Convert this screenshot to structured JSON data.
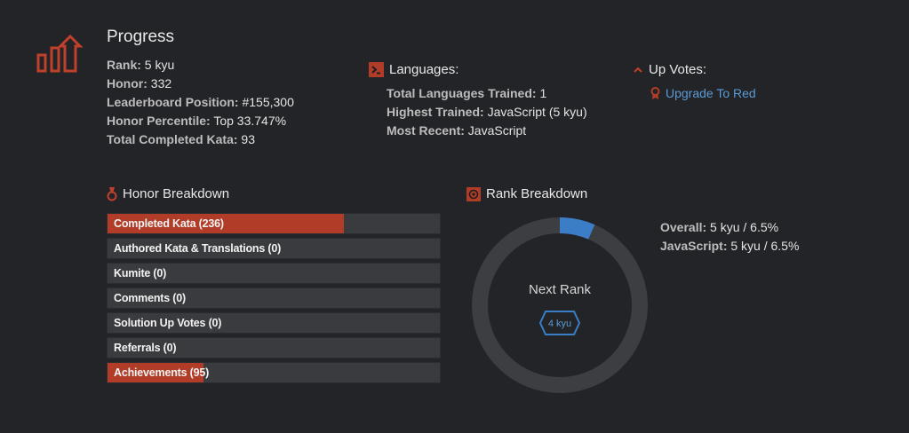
{
  "progress": {
    "title": "Progress",
    "icon": "bar-chart-up-arrow-icon",
    "rank_label": "Rank:",
    "rank": "5 kyu",
    "honor_label": "Honor:",
    "honor": "332",
    "leaderboard_label": "Leaderboard Position:",
    "leaderboard": "#155,300",
    "percentile_label": "Honor Percentile:",
    "percentile": "Top 33.747%",
    "completed_label": "Total Completed Kata:",
    "completed": "93"
  },
  "languages": {
    "title": "Languages:",
    "icon": "terminal-icon",
    "trained_label": "Total Languages Trained:",
    "trained": "1",
    "highest_label": "Highest Trained:",
    "highest": "JavaScript (5 kyu)",
    "recent_label": "Most Recent:",
    "recent": "JavaScript"
  },
  "upvotes": {
    "title": "Up Votes:",
    "icon": "chevron-up-icon",
    "link_icon": "ribbon-icon",
    "link": "Upgrade To Red"
  },
  "honor_breakdown": {
    "title": "Honor Breakdown",
    "icon": "medal-icon",
    "bars": [
      {
        "label": "Completed Kata (236)",
        "fraction": 0.71
      },
      {
        "label": "Authored Kata & Translations (0)",
        "fraction": 0
      },
      {
        "label": "Kumite (0)",
        "fraction": 0
      },
      {
        "label": "Comments (0)",
        "fraction": 0
      },
      {
        "label": "Solution Up Votes (0)",
        "fraction": 0
      },
      {
        "label": "Referrals (0)",
        "fraction": 0
      },
      {
        "label": "Achievements (95)",
        "fraction": 0.29
      }
    ]
  },
  "rank_breakdown": {
    "title": "Rank Breakdown",
    "icon": "target-icon",
    "center_text": "Next Rank",
    "next_rank": "4 kyu",
    "progress_fraction": 0.065,
    "overall_label": "Overall:",
    "overall": "5 kyu / 6.5%",
    "js_label": "JavaScript:",
    "js": "5 kyu / 6.5%"
  },
  "colors": {
    "background": "#232427",
    "accent_red": "#b13c28",
    "accent_blue": "#3b7ec7",
    "link_blue": "#5b9bd5"
  }
}
